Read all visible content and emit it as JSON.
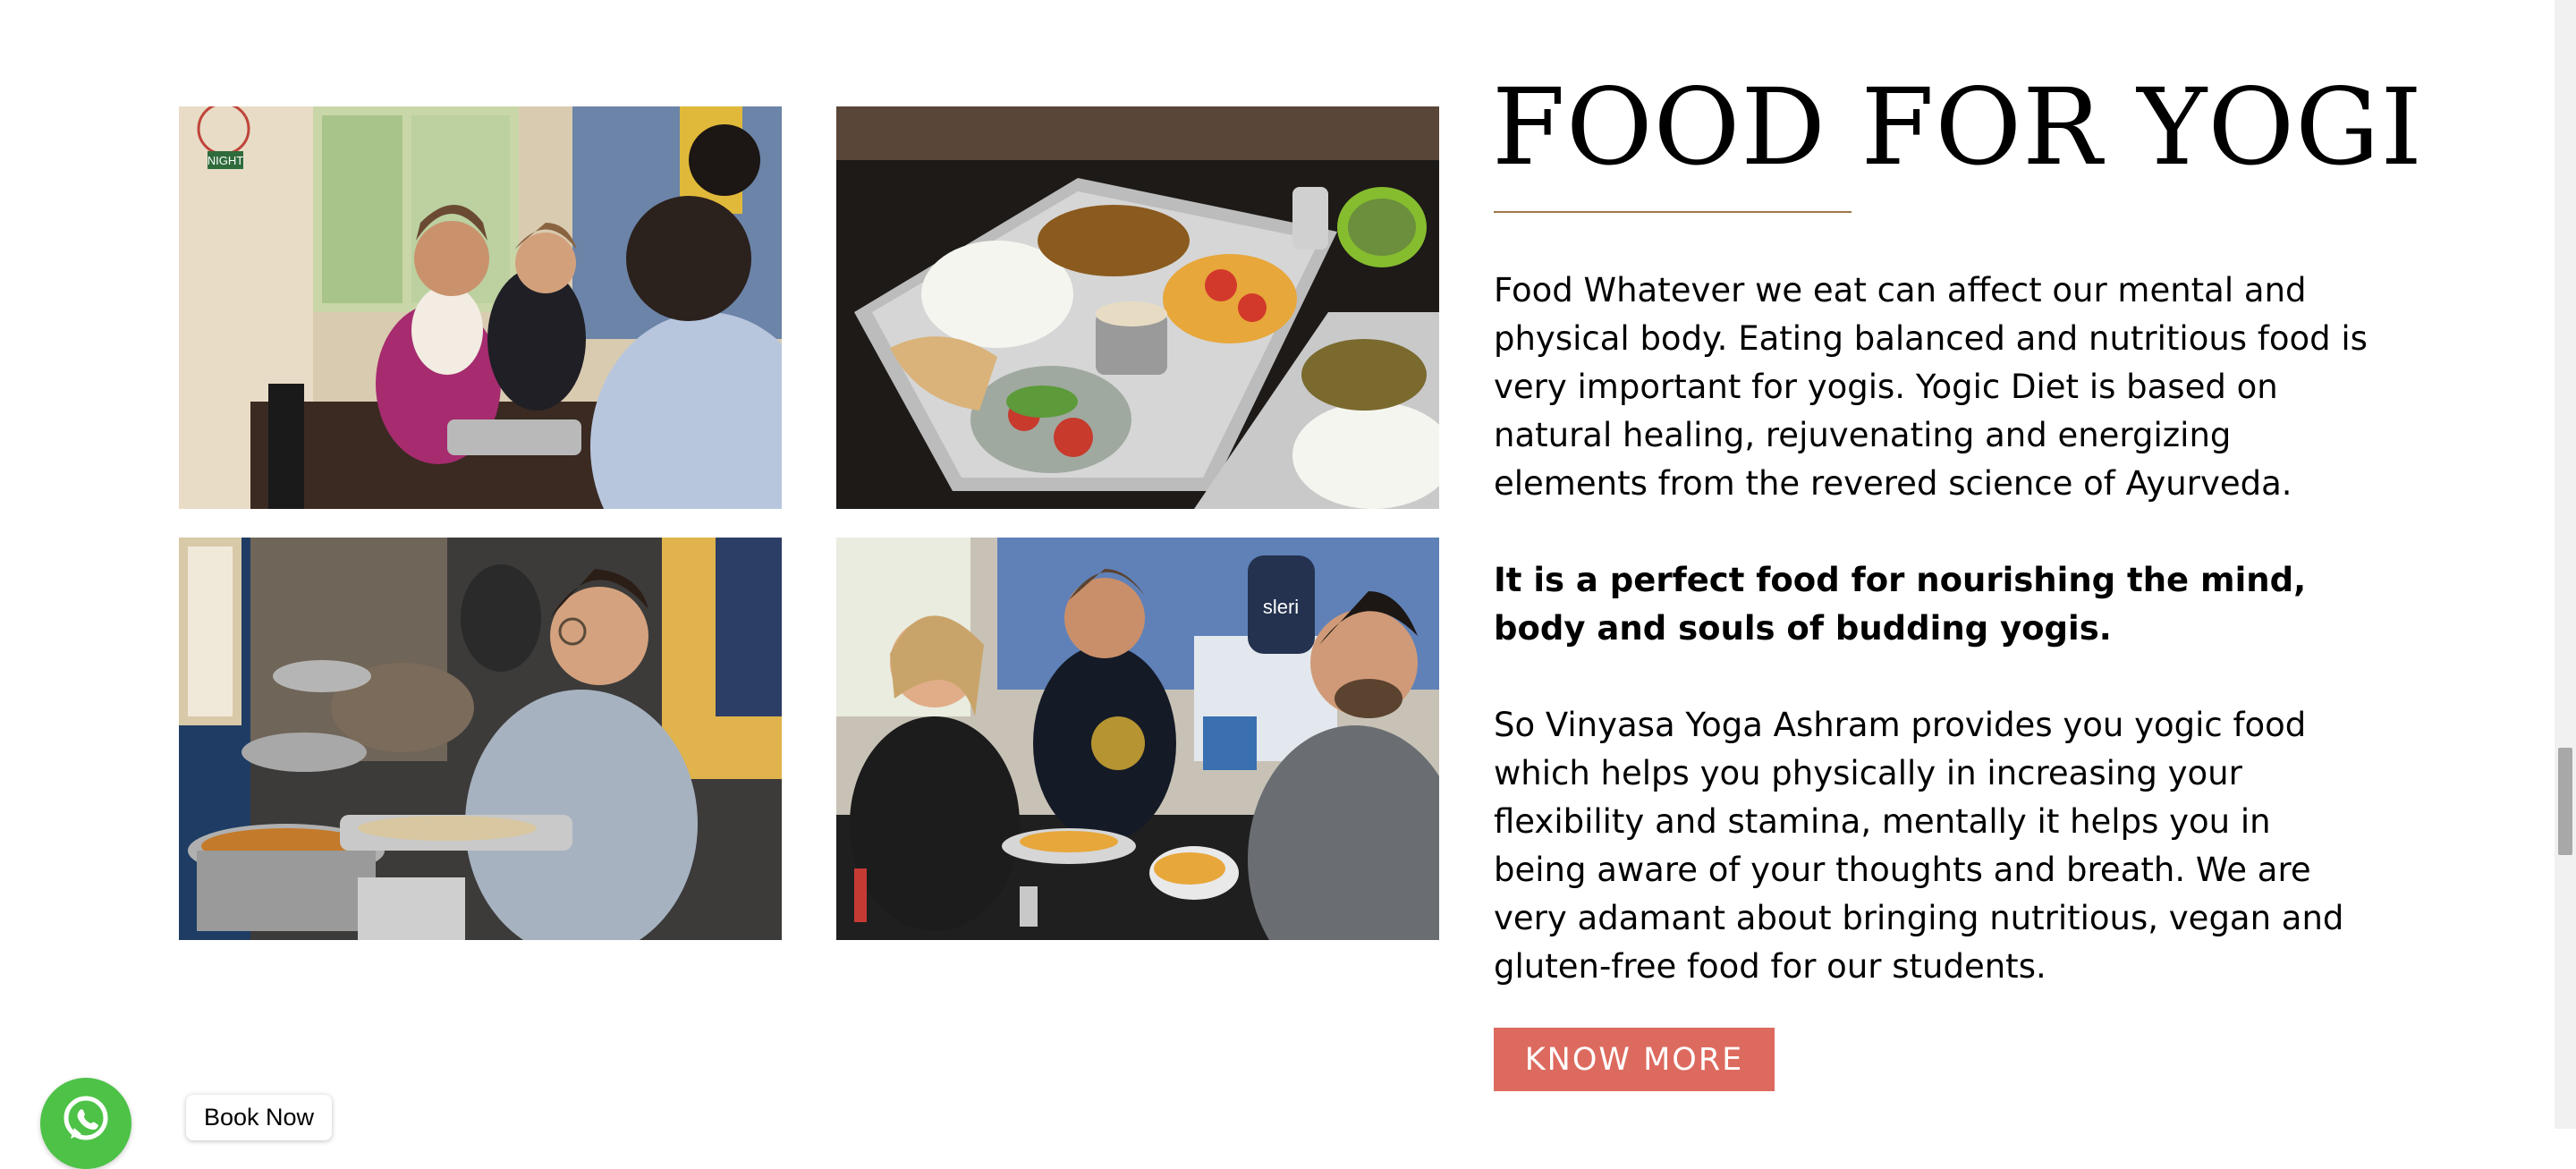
{
  "section": {
    "heading": "FOOD FOR YOGI",
    "paragraphs": [
      "Food Whatever we eat can affect our mental and physical body. Eating balanced and nutritious food is very important for yogis. Yogic Diet is based on natural healing, rejuvenating and energizing elements from the revered science of Ayurveda.",
      "It is a perfect food for nourishing the mind, body and souls of budding yogis.",
      "So Vinyasa Yoga Ashram provides you yogic food which helps you physically in increasing your flexibility and stamina, mentally it helps you in being aware of your thoughts and breath. We are very adamant about bringing nutritious, vegan and gluten-free food for our students."
    ],
    "cta_label": "KNOW MORE"
  },
  "gallery": {
    "photos": [
      {
        "subject": "students eating at dining table"
      },
      {
        "subject": "thali plate with rice, chapati and curries"
      },
      {
        "subject": "student serving food at buffet"
      },
      {
        "subject": "students chatting over meal"
      }
    ],
    "sign_texts": {
      "night": "NIGHT",
      "bottle": "sleri"
    }
  },
  "widgets": {
    "whatsapp_icon": "whatsapp-icon",
    "book_now_label": "Book Now"
  },
  "colors": {
    "accent_button": "#dd6a5e",
    "heading_rule": "#a0764b",
    "whatsapp_green": "#4dc247"
  }
}
